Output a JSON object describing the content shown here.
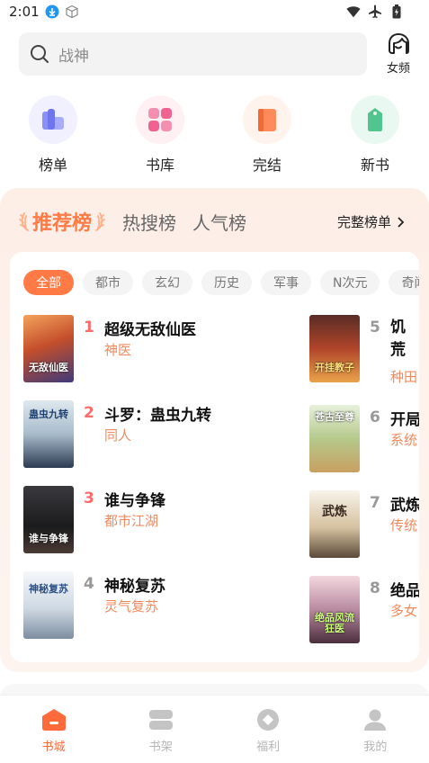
{
  "status_bar": {
    "time": "2:01",
    "icons": [
      "download-badge-icon",
      "cube-icon",
      "wifi-icon",
      "airplane-icon",
      "battery-icon"
    ]
  },
  "search": {
    "placeholder": "战神"
  },
  "gender_switch": {
    "label": "女频"
  },
  "categories": [
    {
      "label": "榜单",
      "icon": "ranking-icon",
      "color": "#7c83f5"
    },
    {
      "label": "书库",
      "icon": "library-icon",
      "color": "#f06292"
    },
    {
      "label": "完结",
      "icon": "finished-book-icon",
      "color": "#ff7a45"
    },
    {
      "label": "新书",
      "icon": "new-book-tag-icon",
      "color": "#52c58e"
    }
  ],
  "ranking": {
    "tabs": [
      "推荐榜",
      "热搜榜",
      "人气榜"
    ],
    "active_tab": "推荐榜",
    "full_list_label": "完整榜单",
    "filters": [
      "全部",
      "都市",
      "玄幻",
      "历史",
      "军事",
      "N次元",
      "奇闻怪谈"
    ],
    "active_filter": "全部",
    "books": [
      {
        "rank": "1",
        "title": "超级无敌仙医",
        "tag": "神医",
        "cover_text": "无敌仙医"
      },
      {
        "rank": "2",
        "title": "斗罗：蛊虫九转",
        "tag": "同人",
        "cover_text": "蛊虫九转"
      },
      {
        "rank": "3",
        "title": "谁与争锋",
        "tag": "都市江湖",
        "cover_text": "谁与争锋"
      },
      {
        "rank": "4",
        "title": "神秘复苏",
        "tag": "灵气复苏",
        "cover_text": "神秘复苏"
      },
      {
        "rank": "5",
        "title": "饥荒婆开",
        "tag": "种田",
        "cover_text": "开挂教子"
      },
      {
        "rank": "6",
        "title": "开局",
        "tag": "系统",
        "cover_text": "苍古至尊"
      },
      {
        "rank": "7",
        "title": "武炼",
        "tag": "传统",
        "cover_text": "武炼"
      },
      {
        "rank": "8",
        "title": "绝品",
        "tag": "多女",
        "cover_text": "绝品风流狂医"
      }
    ],
    "rank_colors": {
      "top": "#ff6a6a",
      "normal": "#999999"
    }
  },
  "bottom_nav": [
    {
      "label": "书城",
      "icon": "bookstore-icon",
      "active": true
    },
    {
      "label": "书架",
      "icon": "bookshelf-icon",
      "active": false
    },
    {
      "label": "福利",
      "icon": "welfare-coin-icon",
      "active": false
    },
    {
      "label": "我的",
      "icon": "profile-icon",
      "active": false
    }
  ],
  "colors": {
    "accent": "#ff7a45",
    "tag": "#f08a5d"
  }
}
